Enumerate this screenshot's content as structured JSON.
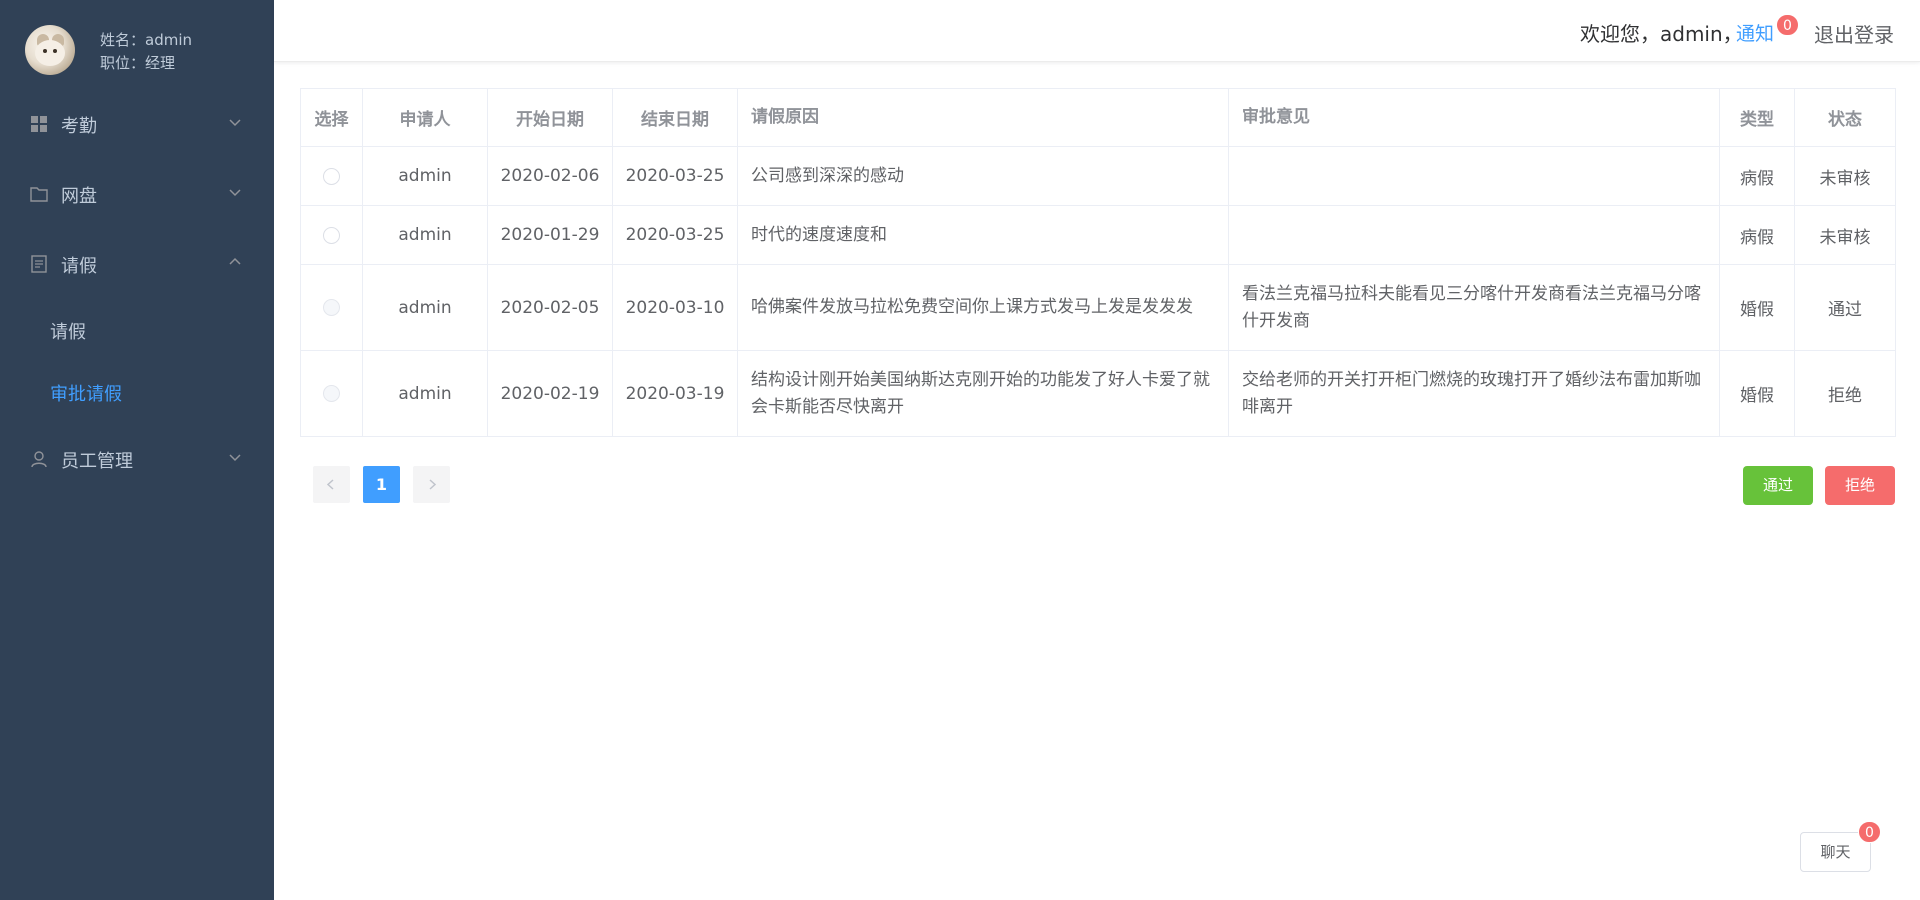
{
  "profile": {
    "name_line": "姓名：admin",
    "position_line": "职位：经理"
  },
  "sidebar": {
    "menus": [
      {
        "label": "考勤",
        "icon": "grid-icon",
        "expanded": false
      },
      {
        "label": "网盘",
        "icon": "folder-icon",
        "expanded": false
      },
      {
        "label": "请假",
        "icon": "document-icon",
        "expanded": true
      },
      {
        "label": "员工管理",
        "icon": "user-icon",
        "expanded": false
      }
    ],
    "leave_sub": [
      {
        "label": "请假",
        "active": false
      },
      {
        "label": "审批请假",
        "active": true
      }
    ]
  },
  "header": {
    "welcome": "欢迎您，admin，",
    "notify_label": "通知",
    "notify_count": "0",
    "logout_label": "退出登录"
  },
  "table": {
    "columns": [
      "选择",
      "申请人",
      "开始日期",
      "结束日期",
      "请假原因",
      "审批意见",
      "类型",
      "状态"
    ],
    "rows": [
      {
        "applicant": "admin",
        "start": "2020-02-06",
        "end": "2020-03-25",
        "reason": "公司感到深深的感动",
        "opinion": "",
        "type": "病假",
        "status": "未审核",
        "selectable": true
      },
      {
        "applicant": "admin",
        "start": "2020-01-29",
        "end": "2020-03-25",
        "reason": "时代的速度速度和",
        "opinion": "",
        "type": "病假",
        "status": "未审核",
        "selectable": true
      },
      {
        "applicant": "admin",
        "start": "2020-02-05",
        "end": "2020-03-10",
        "reason": "哈佛案件发放马拉松免费空间你上课方式发马上发是发发发",
        "opinion": "看法兰克福马拉科夫能看见三分喀什开发商看法兰克福马分喀什开发商",
        "type": "婚假",
        "status": "通过",
        "selectable": false
      },
      {
        "applicant": "admin",
        "start": "2020-02-19",
        "end": "2020-03-19",
        "reason": "结构设计刚开始美国纳斯达克刚开始的功能发了好人卡爱了就会卡斯能否尽快离开",
        "opinion": "交给老师的开关打开柜门燃烧的玫瑰打开了婚纱法布雷加斯咖啡离开",
        "type": "婚假",
        "status": "拒绝",
        "selectable": false
      }
    ]
  },
  "pagination": {
    "current_page": "1"
  },
  "actions": {
    "pass_label": "通过",
    "reject_label": "拒绝"
  },
  "chat": {
    "label": "聊天",
    "count": "0"
  },
  "colors": {
    "sidebar_bg": "#304156",
    "accent": "#409eff",
    "success": "#67c23a",
    "danger": "#f56c6c"
  }
}
